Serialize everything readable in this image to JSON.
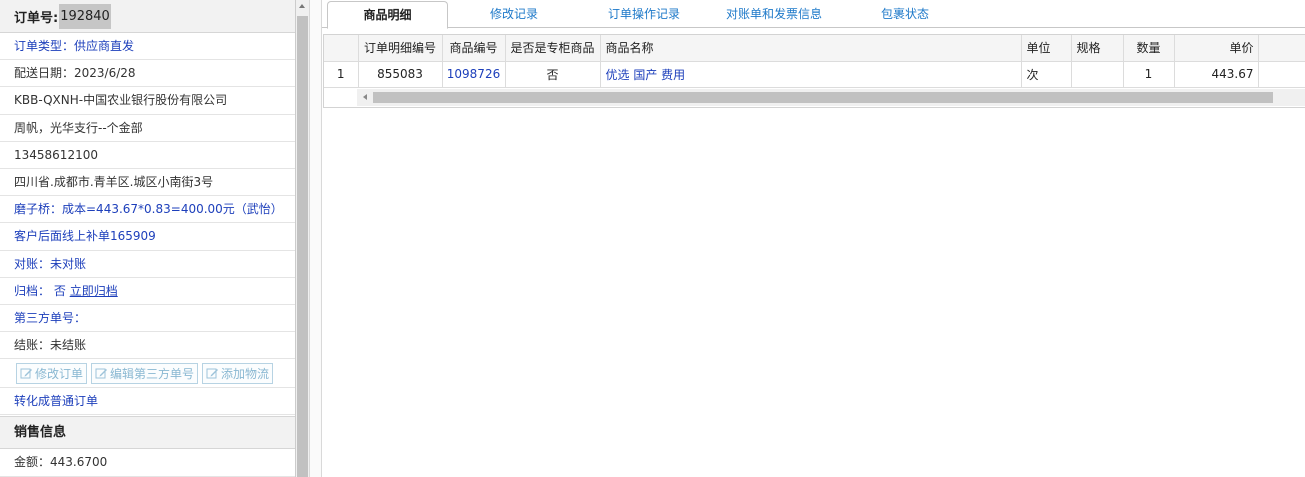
{
  "order": {
    "label": "订单号:",
    "number": "192840",
    "type": "订单类型：供应商直发",
    "delivery_date": "配送日期：2023/6/28",
    "company": "KBB-QXNH-中国农业银行股份有限公司",
    "contact": "周帆，光华支行--个金部",
    "phone": "13458612100",
    "address": "四川省.成都市.青羊区.城区小南街3号",
    "note": "磨子桥：成本=443.67*0.83=400.00元（武怡）",
    "supplement": "客户后面线上补单165909",
    "reconcile": "对账：未对账",
    "archive_label": "归档：",
    "archive_value": "否",
    "archive_link": "立即归档",
    "third_party": "第三方单号：",
    "settlement": "结账：未结账",
    "buttons": {
      "edit_order": "修改订单",
      "edit_third_party": "编辑第三方单号",
      "add_logistics": "添加物流"
    },
    "convert": "转化成普通订单"
  },
  "sales": {
    "title": "销售信息",
    "amount": "金额：443.6700"
  },
  "tabs": [
    "商品明细",
    "修改记录",
    "订单操作记录",
    "对账单和发票信息",
    "包裹状态"
  ],
  "table": {
    "headers": [
      "",
      "订单明细编号",
      "商品编号",
      "是否是专柜商品",
      "商品名称",
      "单位",
      "规格",
      "数量",
      "单价"
    ],
    "rows": [
      [
        "1",
        "855083",
        "1098726",
        "否",
        "优选 国产 费用",
        "次",
        "",
        "1",
        "443.67"
      ]
    ]
  },
  "colors": {
    "link_blue": "#1d3fbb",
    "tab_blue": "#1e79c9",
    "disabled_button": "#8ab8d2"
  }
}
